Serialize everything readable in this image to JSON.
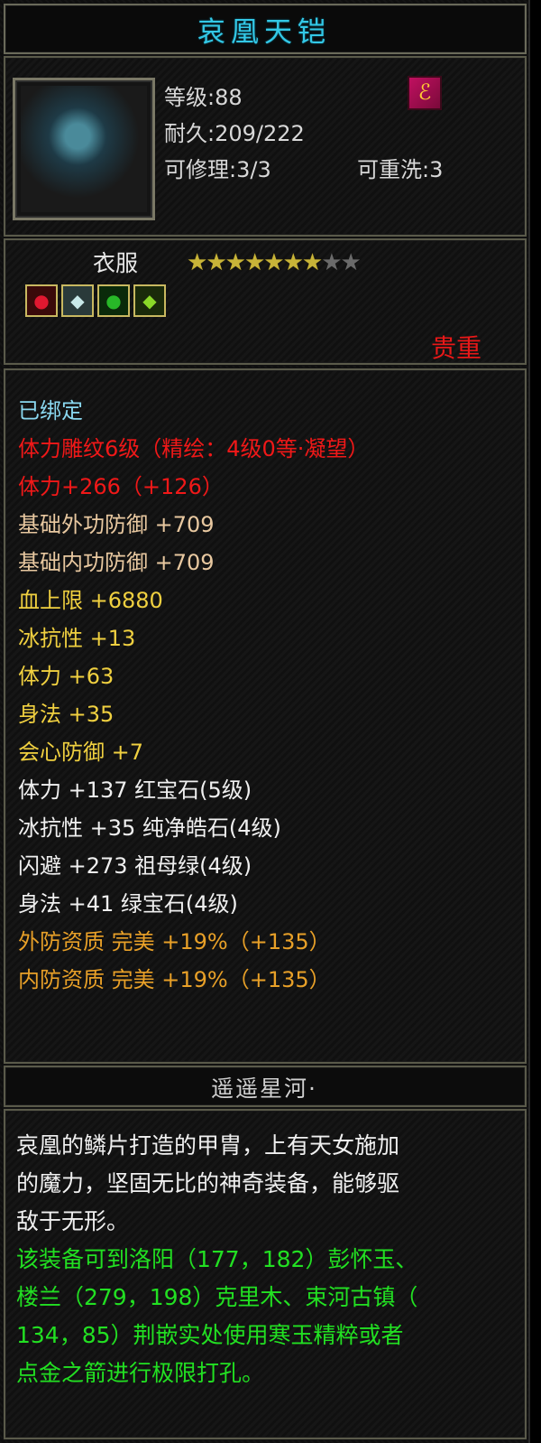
{
  "item": {
    "name": "哀凰天铠",
    "level": "等级:88",
    "durability": "耐久:209/222",
    "repairable": "可修理:3/3",
    "rewashable": "可重洗:3",
    "type": "衣服",
    "stars_total": 9,
    "stars_filled": 7,
    "rarity": "贵重"
  },
  "attributes": [
    {
      "text": "已绑定",
      "color": "blue"
    },
    {
      "text": "体力雕纹6级（精绘：4级0等·凝望）",
      "color": "red"
    },
    {
      "text": "体力+266（+126）",
      "color": "red"
    },
    {
      "text": "基础外功防御 +709",
      "color": "tan"
    },
    {
      "text": "基础内功防御 +709",
      "color": "tan"
    },
    {
      "text": "血上限 +6880",
      "color": "yellow"
    },
    {
      "text": "冰抗性 +13",
      "color": "yellow"
    },
    {
      "text": "体力 +63",
      "color": "yellow"
    },
    {
      "text": "身法 +35",
      "color": "yellow"
    },
    {
      "text": "会心防御 +7",
      "color": "yellow"
    },
    {
      "text": "体力 +137 红宝石(5级)",
      "color": "white"
    },
    {
      "text": "冰抗性 +35 纯净皓石(4级)",
      "color": "white"
    },
    {
      "text": "闪避 +273 祖母绿(4级)",
      "color": "white"
    },
    {
      "text": "身法 +41 绿宝石(4级)",
      "color": "white"
    },
    {
      "text": "外防资质  完美 +19%（+135）",
      "color": "orange"
    },
    {
      "text": "内防资质  完美 +19%（+135）",
      "color": "orange"
    }
  ],
  "maker": "遥遥星河·",
  "description": {
    "lines": [
      "哀凰的鳞片打造的甲胄，上有天女施加",
      "的魔力，坚固无比的神奇装备，能够驱",
      "敌于无形。"
    ],
    "hint_lines": [
      "该装备可到洛阳（177，182）彭怀玉、",
      "楼兰（279，198）克里木、束河古镇（",
      "134，85）荆嵌实处使用寒玉精粹或者",
      "点金之箭进行极限打孔。"
    ]
  },
  "colors": {
    "title": "#33c8e6",
    "rarity": "#e81818",
    "hint": "#22e022"
  }
}
